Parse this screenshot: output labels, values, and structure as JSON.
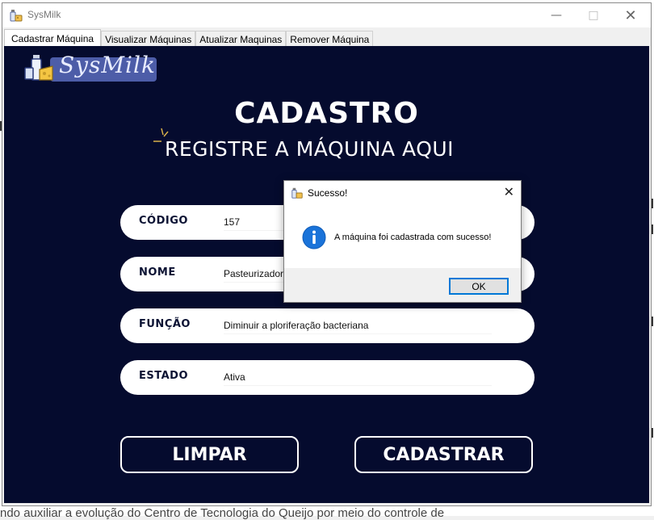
{
  "window": {
    "title": "SysMilk"
  },
  "tabs": [
    {
      "label": "Cadastrar Máquina",
      "active": true
    },
    {
      "label": "Visualizar Máquinas",
      "active": false
    },
    {
      "label": "Atualizar Maquinas",
      "active": false
    },
    {
      "label": "Remover Máquina",
      "active": false
    }
  ],
  "logo": {
    "text": "SysMilk"
  },
  "heading": {
    "title": "CADASTRO",
    "subtitle": "REGISTRE A MÁQUINA AQUI"
  },
  "form": {
    "fields": [
      {
        "label": "CÓDIGO",
        "value": "157"
      },
      {
        "label": "NOME",
        "value": "Pasteurizador"
      },
      {
        "label": "FUNÇÃO",
        "value": "Diminuir a ploriferação bacteriana"
      },
      {
        "label": "ESTADO",
        "value": "Ativa"
      }
    ],
    "clear_label": "LIMPAR",
    "submit_label": "CADASTRAR"
  },
  "dialog": {
    "title": "Sucesso!",
    "message": "A máquina foi cadastrada com sucesso!",
    "ok_label": "OK"
  },
  "background": {
    "bottom_text": "ndo auxiliar a evolução do Centro de Tecnologia do Queijo por meio do controle de"
  },
  "colors": {
    "panel_bg": "#050b2e",
    "logo_bg": "#4d5da8",
    "info_blue": "#0078d7"
  },
  "icons": [
    "app-icon",
    "minimize-icon",
    "maximize-icon",
    "close-icon",
    "sparkle-icon",
    "info-icon"
  ]
}
